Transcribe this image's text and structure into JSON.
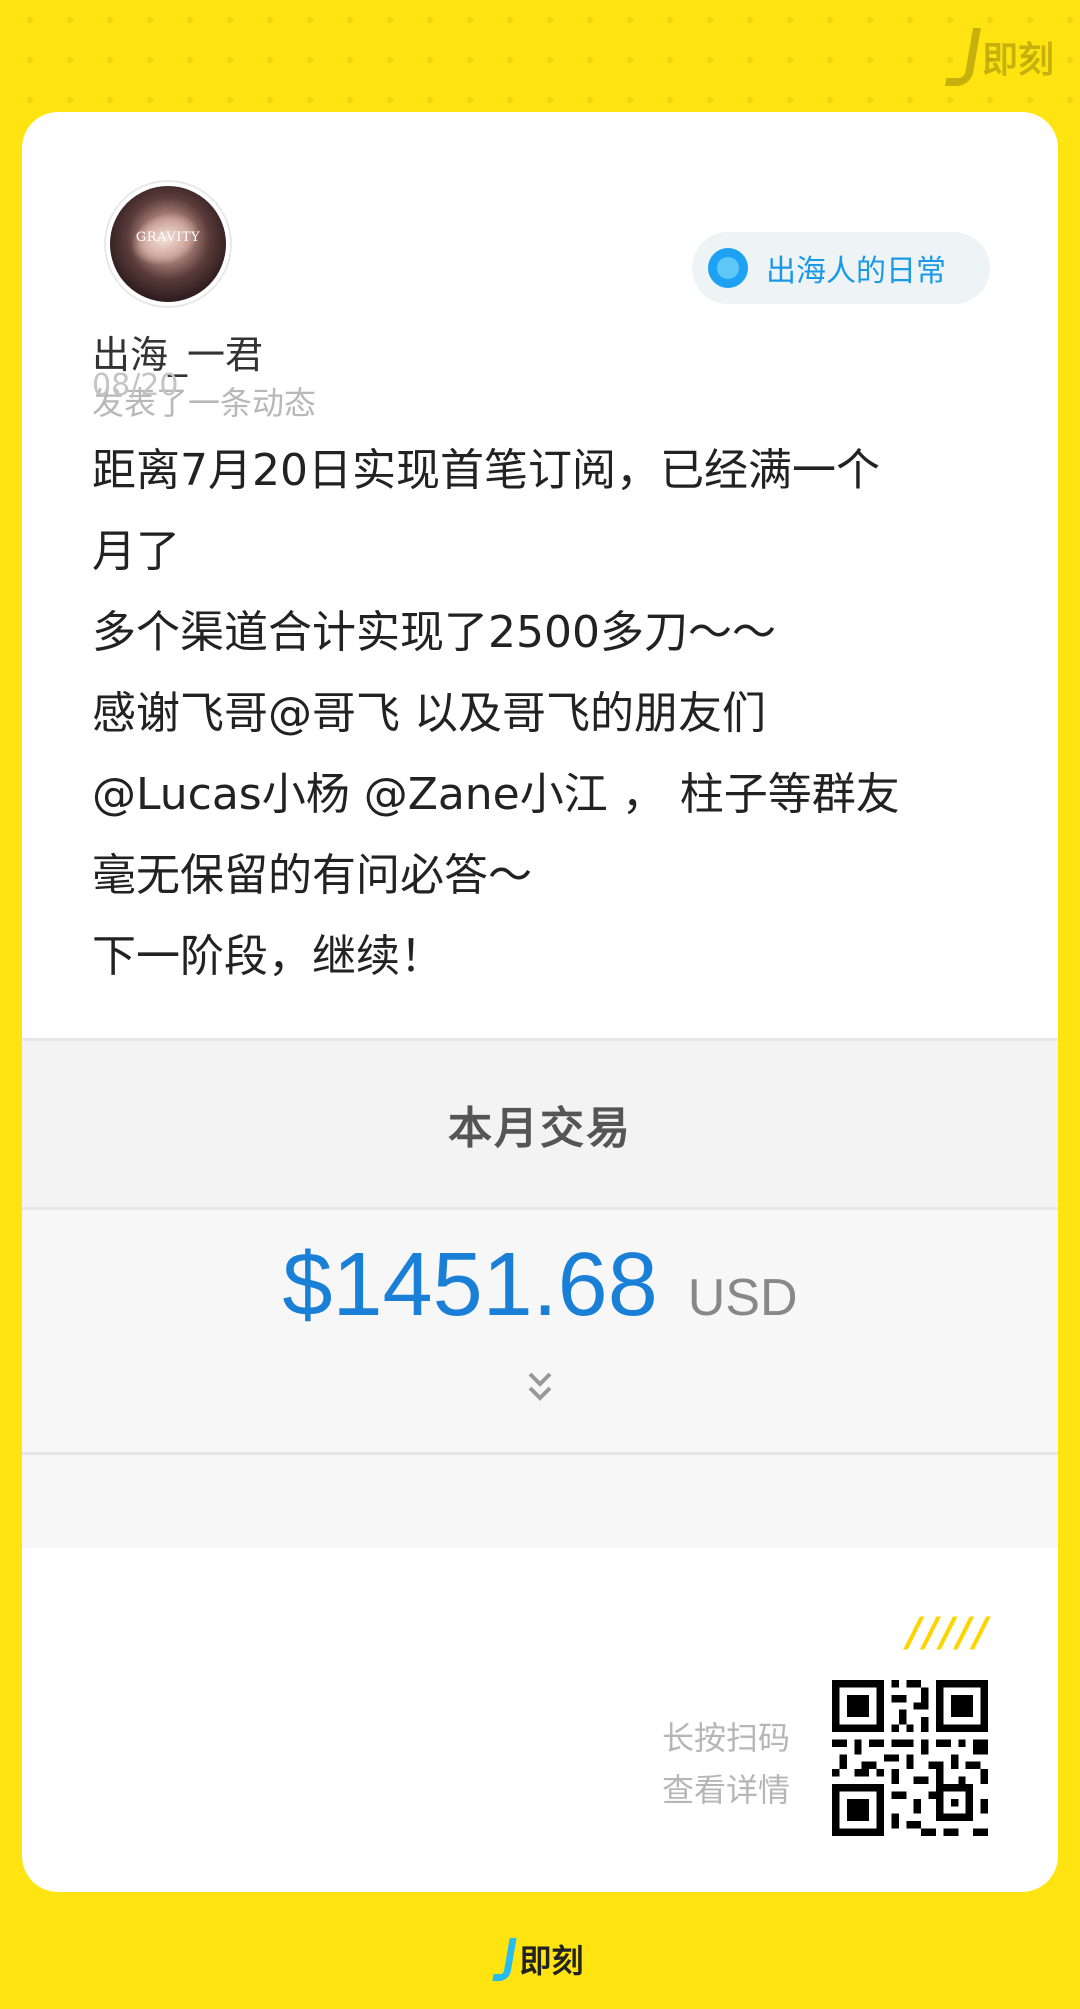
{
  "brand": {
    "name": "即刻"
  },
  "user": {
    "name": "出海_一君",
    "action": "发表了一条动态",
    "avatar_text": "GRAVITY"
  },
  "topic": {
    "label": "出海人的日常"
  },
  "post": {
    "date": "08/20",
    "lines": [
      "距离7月20日实现首笔订阅，已经满一个",
      "月了",
      "多个渠道合计实现了2500多刀～～",
      "感谢飞哥@哥飞 以及哥飞的朋友们",
      "@Lucas小杨 @Zane小江 ， 柱子等群友",
      "毫无保留的有问必答～",
      "下一阶段，继续！"
    ]
  },
  "embed": {
    "header": "本月交易",
    "amount": "$1451.68",
    "currency": "USD",
    "chevron": "»"
  },
  "footer": {
    "slashes": "/////",
    "qr_line1": "长按扫码",
    "qr_line2": "查看详情"
  },
  "colors": {
    "background": "#FFE411",
    "accent_blue": "#1a7fd6",
    "topic_blue": "#1a9ae6",
    "slash_yellow": "#FFD500"
  },
  "icons": {
    "brand_logo": "jike-j-icon",
    "topic": "topic-circle-icon",
    "expand": "double-chevron-down-icon",
    "qr": "qr-code-icon"
  }
}
